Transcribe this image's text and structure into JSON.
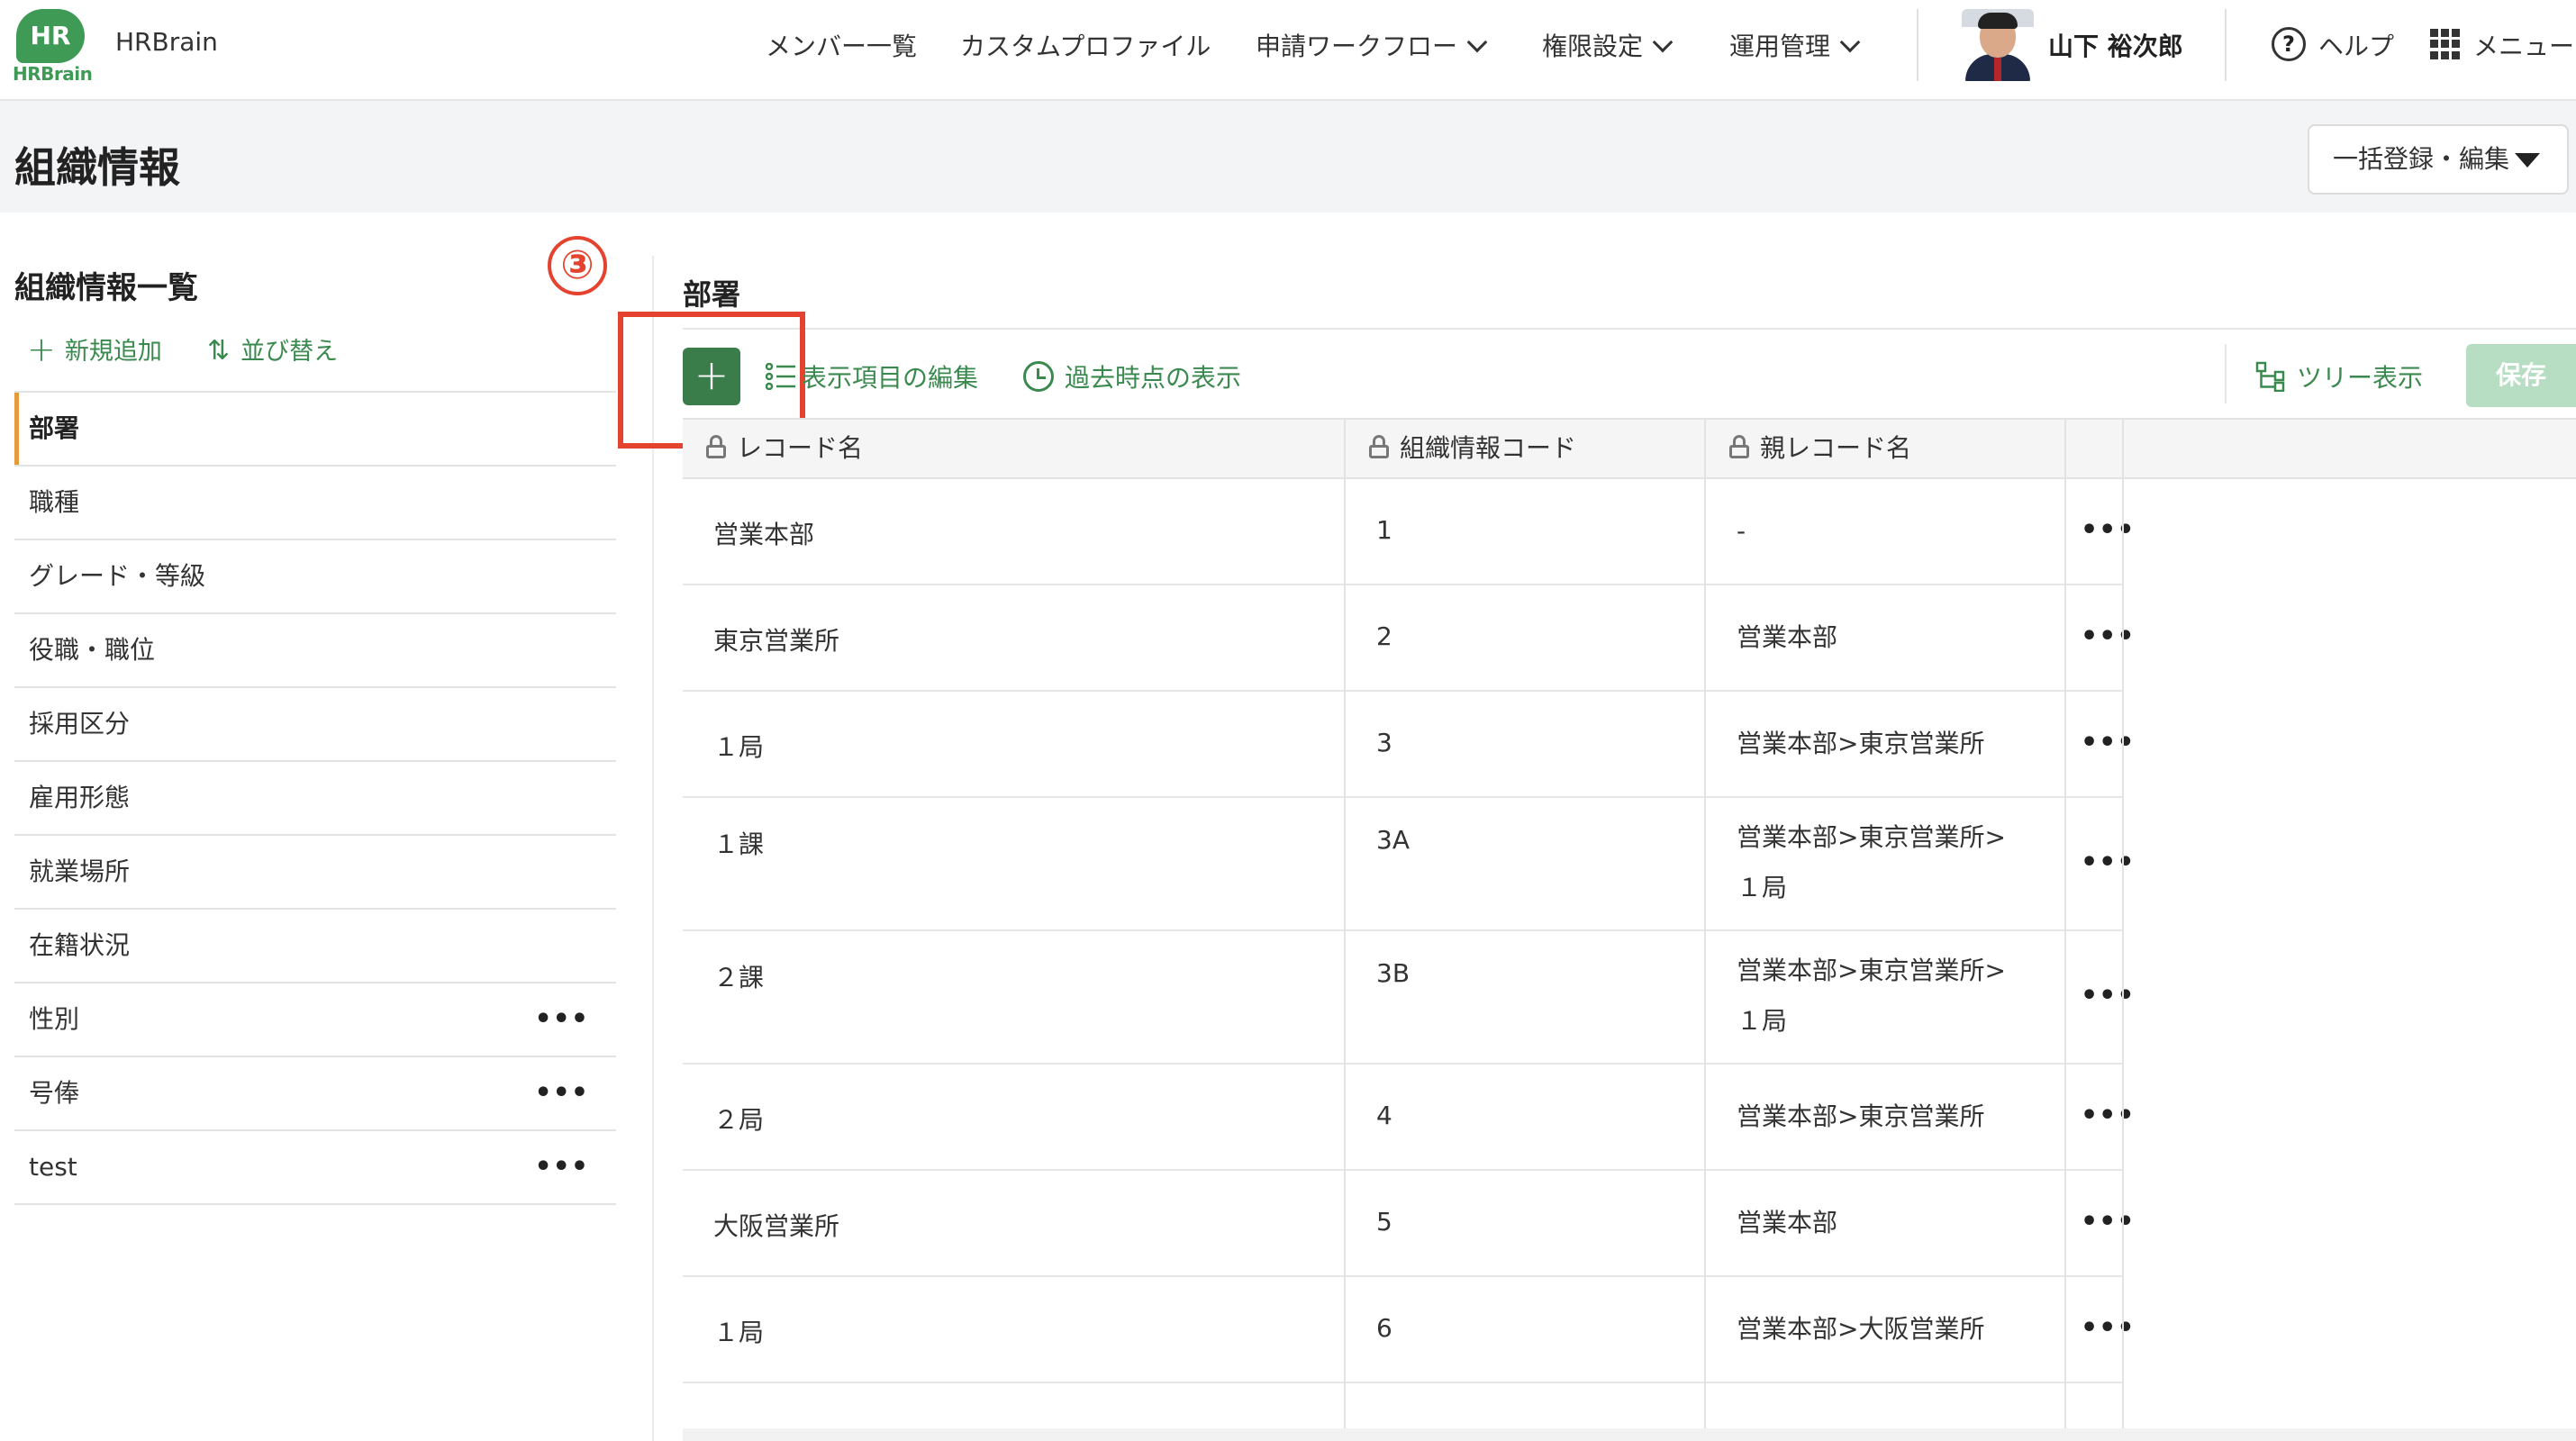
{
  "header": {
    "logo_mark": "HR",
    "logo_word": "HRBrain",
    "brand": "HRBrain",
    "nav": [
      {
        "label": "メンバー一覧",
        "dropdown": false
      },
      {
        "label": "カスタムプロファイル",
        "dropdown": false
      },
      {
        "label": "申請ワークフロー",
        "dropdown": true
      },
      {
        "label": "権限設定",
        "dropdown": true
      },
      {
        "label": "運用管理",
        "dropdown": true
      }
    ],
    "user_name": "山下 裕次郎",
    "help_glyph": "?",
    "help_label": "ヘルプ",
    "menu_label": "メニュー"
  },
  "page": {
    "title": "組織情報",
    "bulk_button": "一括登録・編集"
  },
  "left_panel": {
    "title": "組織情報一覧",
    "step_marker": "③",
    "add_label": "新規追加",
    "sort_label": "並び替え",
    "items": [
      {
        "label": "部署",
        "active": true,
        "has_menu": false
      },
      {
        "label": "職種",
        "active": false,
        "has_menu": false
      },
      {
        "label": "グレード・等級",
        "active": false,
        "has_menu": false
      },
      {
        "label": "役職・職位",
        "active": false,
        "has_menu": false
      },
      {
        "label": "採用区分",
        "active": false,
        "has_menu": false
      },
      {
        "label": "雇用形態",
        "active": false,
        "has_menu": false
      },
      {
        "label": "就業場所",
        "active": false,
        "has_menu": false
      },
      {
        "label": "在籍状況",
        "active": false,
        "has_menu": false
      },
      {
        "label": "性別",
        "active": false,
        "has_menu": true
      },
      {
        "label": "号俸",
        "active": false,
        "has_menu": true
      },
      {
        "label": "test",
        "active": false,
        "has_menu": true
      }
    ],
    "item_menu_glyph": "•••"
  },
  "main": {
    "section_title": "部署",
    "add_glyph": "+",
    "edit_columns_label": "表示項目の編集",
    "history_label": "過去時点の表示",
    "tree_label": "ツリー表示",
    "save_label": "保存",
    "columns": [
      "レコード名",
      "組織情報コード",
      "親レコード名"
    ],
    "row_menu_glyph": "•••",
    "rows": [
      {
        "name": "営業本部",
        "code": "1",
        "parent": "-"
      },
      {
        "name": "東京営業所",
        "code": "2",
        "parent": "営業本部"
      },
      {
        "name": "１局",
        "code": "3",
        "parent": "営業本部>東京営業所"
      },
      {
        "name": "１課",
        "code": "3A",
        "parent": "営業本部>東京営業所>１局"
      },
      {
        "name": "２課",
        "code": "3B",
        "parent": "営業本部>東京営業所>１局"
      },
      {
        "name": "２局",
        "code": "4",
        "parent": "営業本部>東京営業所"
      },
      {
        "name": "大阪営業所",
        "code": "5",
        "parent": "営業本部"
      },
      {
        "name": "１局",
        "code": "6",
        "parent": "営業本部>大阪営業所"
      }
    ]
  },
  "colors": {
    "brand_green": "#3f9a55",
    "action_green": "#3a8a4f",
    "button_green": "#3a7d4a",
    "save_disabled": "#b7ddc3",
    "annotation_red": "#e4442f",
    "active_marker": "#e59b3c"
  }
}
